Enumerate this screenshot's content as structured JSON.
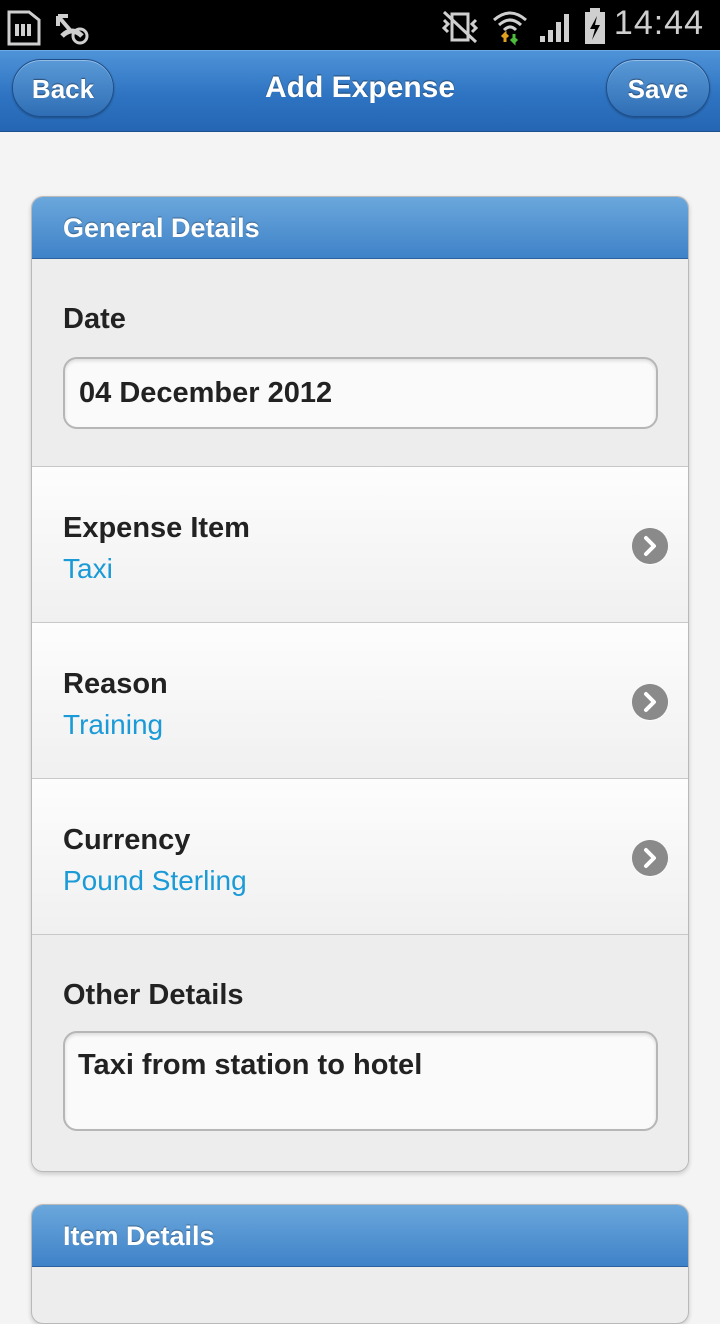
{
  "status_bar": {
    "time": "14:44",
    "icons": [
      "sd-card-icon",
      "missed-call-icon",
      "vibrate-mute-icon",
      "wifi-icon",
      "signal-icon",
      "battery-charging-icon"
    ]
  },
  "header": {
    "title": "Add Expense",
    "back_label": "Back",
    "save_label": "Save"
  },
  "general_details": {
    "title": "General Details",
    "date": {
      "label": "Date",
      "value": "04 December 2012"
    },
    "expense_item": {
      "label": "Expense Item",
      "value": "Taxi"
    },
    "reason": {
      "label": "Reason",
      "value": "Training"
    },
    "currency": {
      "label": "Currency",
      "value": "Pound Sterling"
    },
    "other_details": {
      "label": "Other Details",
      "value": "Taxi from station to hotel"
    }
  },
  "item_details": {
    "title": "Item Details"
  },
  "colors": {
    "accent_value": "#1a9ad6",
    "header_blue": "#2e74c2"
  }
}
